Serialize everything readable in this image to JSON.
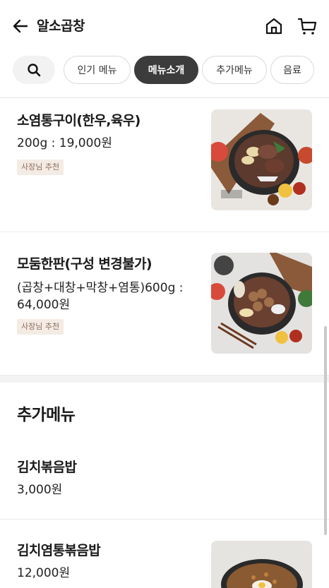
{
  "header": {
    "title": "알소곱창",
    "back_icon": "arrow-left-icon",
    "home_icon": "home-icon",
    "cart_icon": "cart-icon"
  },
  "chips": {
    "search_icon": "search-icon",
    "items": [
      {
        "label": "인기 메뉴",
        "active": false
      },
      {
        "label": "메뉴소개",
        "active": true
      },
      {
        "label": "추가메뉴",
        "active": false
      },
      {
        "label": "음료",
        "active": false
      }
    ]
  },
  "menu": [
    {
      "name": "소염통구이(한우,육우)",
      "desc": "200g : 19,000원",
      "badge": "사장님 추천"
    },
    {
      "name": "모둠한판(구성 변경불가)",
      "desc": "(곱창+대창+막창+염통)600g : 64,000원",
      "badge": "사장님 추천"
    }
  ],
  "extra": {
    "title": "추가메뉴",
    "items": [
      {
        "name": "김치볶음밥",
        "price": "3,000원"
      },
      {
        "name": "김치염통볶음밥",
        "price": "12,000원"
      }
    ]
  },
  "colors": {
    "active_chip": "#3c3c3c",
    "badge_bg": "#f4ebe4",
    "badge_text": "#8a6d5c"
  }
}
